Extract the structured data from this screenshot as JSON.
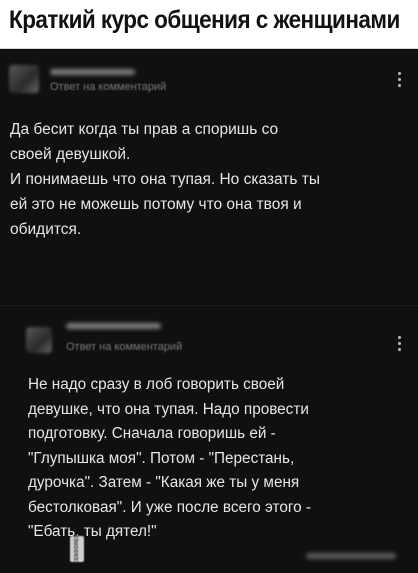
{
  "header": {
    "title": "Краткий курс общения с женщинами"
  },
  "comments": [
    {
      "reply_label": "Ответ на комментарий",
      "text": "Да бесит когда ты прав а споришь со\nсвоей девушкой.\nИ понимаешь что она тупая. Но сказать ты\nей это не можешь потому что она твоя и\nобидится."
    },
    {
      "reply_label": "Ответ на комментарий",
      "text": "Не надо сразу в лоб говорить своей\nдевушке, что она тупая. Надо провести\nподготовку. Сначала говоришь ей -\n\"Глупышка моя\". Потом - \"Перестань,\nдурочка\". Затем - \"Какая же ты у меня\nбестолковая\". И уже после всего этого -\n\"Ебать, ты дятел!\""
    }
  ],
  "stamp": {
    "text": "CENSORED"
  },
  "colors": {
    "background": "#101010",
    "text": "#e6e6e6",
    "header_bg": "#ffffff"
  },
  "icons": [
    "more-vertical-icon",
    "avatar"
  ]
}
